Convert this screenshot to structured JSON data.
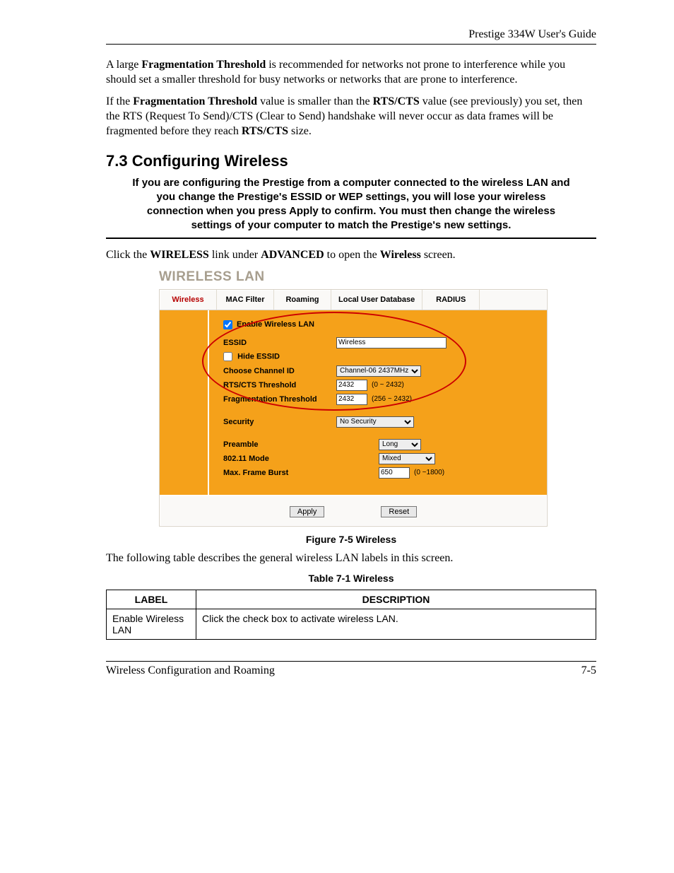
{
  "header": {
    "title": "Prestige 334W User's Guide"
  },
  "body": {
    "p1_a": "A large ",
    "p1_b": "Fragmentation Threshold",
    "p1_c": " is recommended for networks not prone to interference while you should set a smaller threshold for busy networks or networks that are prone to interference.",
    "p2_a": "If the ",
    "p2_b": "Fragmentation Threshold",
    "p2_c": " value is smaller than the ",
    "p2_d": "RTS/CTS",
    "p2_e": " value (see previously) you set, then the RTS (Request To Send)/CTS (Clear to Send) handshake will never occur as data frames will be fragmented before they reach ",
    "p2_f": "RTS/CTS",
    "p2_g": " size."
  },
  "section": {
    "num_title": "7.3    Configuring Wireless"
  },
  "warn": "If you are configuring the Prestige from a computer connected to the wireless LAN and you change the Prestige's ESSID or WEP settings, you will lose your wireless connection when you press Apply to confirm. You must then change the wireless settings of your computer to match the Prestige's new settings.",
  "click_a": "Click the ",
  "click_b": "WIRELESS",
  "click_c": " link under ",
  "click_d": "ADVANCED",
  "click_e": " to open the ",
  "click_f": "Wireless",
  "click_g": " screen.",
  "figure": {
    "heading": "WIRELESS LAN",
    "tabs": [
      "Wireless",
      "MAC Filter",
      "Roaming",
      "Local User Database",
      "RADIUS"
    ],
    "enable_label": "Enable Wireless LAN",
    "labels": {
      "essid": "ESSID",
      "hide": "Hide ESSID",
      "channel": "Choose Channel ID",
      "rts": "RTS/CTS  Threshold",
      "frag": "Fragmentation Threshold",
      "security": "Security",
      "preamble": "Preamble",
      "mode": "802.11 Mode",
      "burst": "Max. Frame Burst"
    },
    "values": {
      "essid": "Wireless",
      "channel": "Channel-06 2437MHz",
      "rts": "2432",
      "rts_range": "(0 ~ 2432)",
      "frag": "2432",
      "frag_range": "(256 ~ 2432)",
      "security": "No Security",
      "preamble": "Long",
      "mode": "Mixed",
      "burst": "650",
      "burst_range": "(0 ~1800)"
    },
    "buttons": {
      "apply": "Apply",
      "reset": "Reset"
    },
    "caption": "Figure 7-5 Wireless"
  },
  "following": "The following table describes the general wireless LAN labels in this screen.",
  "table": {
    "caption": "Table 7-1 Wireless",
    "headers": [
      "LABEL",
      "DESCRIPTION"
    ],
    "rows": [
      {
        "label": "Enable Wireless LAN",
        "desc": "Click the check box to activate wireless LAN."
      }
    ]
  },
  "footer": {
    "left": "Wireless Configuration and Roaming",
    "right": "7-5"
  }
}
